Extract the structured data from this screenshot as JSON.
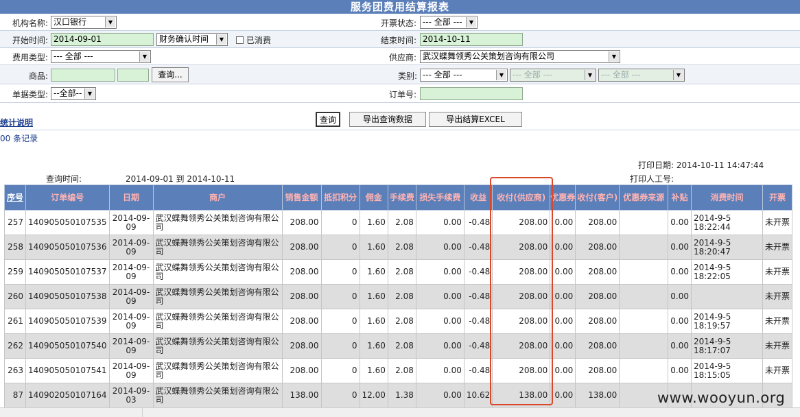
{
  "title": "服务团费用结算报表",
  "filters": {
    "org_label": "机构名称:",
    "org_value": "汉口银行",
    "invoice_label": "开票状态:",
    "invoice_value": "--- 全部 ---",
    "start_label": "开始时间:",
    "start_value": "2014-09-01",
    "time_type_value": "财务确认时间",
    "consumed_label": "已消费",
    "end_label": "结束时间:",
    "end_value": "2014-10-11",
    "fee_type_label": "费用类型:",
    "fee_type_value": "--- 全部 ---",
    "supplier_label": "供应商:",
    "supplier_value": "武汉蝶舞领秀公关策划咨询有限公司",
    "goods_label": "商品:",
    "goods_query_button": "查询...",
    "category_label": "类别:",
    "category_value_1": "--- 全部 ---",
    "category_value_2": "--- 全部 ---",
    "category_value_3": "--- 全部 ---",
    "doc_type_label": "单据类型:",
    "doc_type_value": "--全部--",
    "order_no_label": "订单号:"
  },
  "actions": {
    "stats_link": "统计说明",
    "query_button": "查询",
    "export_query_button": "导出查询数据",
    "export_excel_button": "导出结算EXCEL"
  },
  "record_count": "00 条记录",
  "report_meta": {
    "query_time_label": "查询时间:",
    "query_time_value": "2014-09-01 到 2014-10-11",
    "print_date": "打印日期: 2014-10-11 14:47:44",
    "printer": "打印人工号:"
  },
  "table": {
    "columns": [
      "序号",
      "订单编号",
      "日期",
      "商户",
      "销售金额",
      "抵扣积分",
      "佣金",
      "手续费",
      "损失手续费",
      "收益",
      "收付(供应商)",
      "优惠券",
      "收付(客户)",
      "优惠券来源",
      "补贴",
      "消费时间",
      "开票"
    ],
    "rows": [
      [
        "257",
        "140905050107535",
        "2014-09-09",
        "武汉蝶舞领秀公关策划咨询有限公司",
        "208.00",
        "0",
        "1.60",
        "2.08",
        "0.00",
        "-0.48",
        "208.00",
        "0.00",
        "208.00",
        "",
        "0.00",
        "2014-9-5 18:22:44",
        "未开票"
      ],
      [
        "258",
        "140905050107536",
        "2014-09-09",
        "武汉蝶舞领秀公关策划咨询有限公司",
        "208.00",
        "0",
        "1.60",
        "2.08",
        "0.00",
        "-0.48",
        "208.00",
        "0.00",
        "208.00",
        "",
        "0.00",
        "2014-9-5 18:20:47",
        "未开票"
      ],
      [
        "259",
        "140905050107537",
        "2014-09-09",
        "武汉蝶舞领秀公关策划咨询有限公司",
        "208.00",
        "0",
        "1.60",
        "2.08",
        "0.00",
        "-0.48",
        "208.00",
        "0.00",
        "208.00",
        "",
        "0.00",
        "2014-9-5 18:22:05",
        "未开票"
      ],
      [
        "260",
        "140905050107538",
        "2014-09-09",
        "武汉蝶舞领秀公关策划咨询有限公司",
        "208.00",
        "0",
        "1.60",
        "2.08",
        "0.00",
        "-0.48",
        "208.00",
        "0.00",
        "208.00",
        "",
        "0.00",
        "",
        "未开票"
      ],
      [
        "261",
        "140905050107539",
        "2014-09-09",
        "武汉蝶舞领秀公关策划咨询有限公司",
        "208.00",
        "0",
        "1.60",
        "2.08",
        "0.00",
        "-0.48",
        "208.00",
        "0.00",
        "208.00",
        "",
        "0.00",
        "2014-9-5 18:19:57",
        "未开票"
      ],
      [
        "262",
        "140905050107540",
        "2014-09-09",
        "武汉蝶舞领秀公关策划咨询有限公司",
        "208.00",
        "0",
        "1.60",
        "2.08",
        "0.00",
        "-0.48",
        "208.00",
        "0.00",
        "208.00",
        "",
        "0.00",
        "2014-9-5 18:17:07",
        "未开票"
      ],
      [
        "263",
        "140905050107541",
        "2014-09-09",
        "武汉蝶舞领秀公关策划咨询有限公司",
        "208.00",
        "0",
        "1.60",
        "2.08",
        "0.00",
        "-0.48",
        "208.00",
        "0.00",
        "208.00",
        "",
        "0.00",
        "2014-9-5 18:15:05",
        "未开票"
      ],
      [
        "87",
        "140902050107164",
        "2014-09-03",
        "武汉蝶舞领秀公关策划咨询有限公司",
        "138.00",
        "0",
        "12.00",
        "1.38",
        "0.00",
        "10.62",
        "138.00",
        "0.00",
        "138.00",
        "",
        "",
        "",
        ""
      ]
    ]
  },
  "watermark": "www.wooyun.org",
  "colors": {
    "header_bg": "#5b7fb8",
    "input_bg": "#d7f2d7",
    "highlight": "#d9482b"
  }
}
